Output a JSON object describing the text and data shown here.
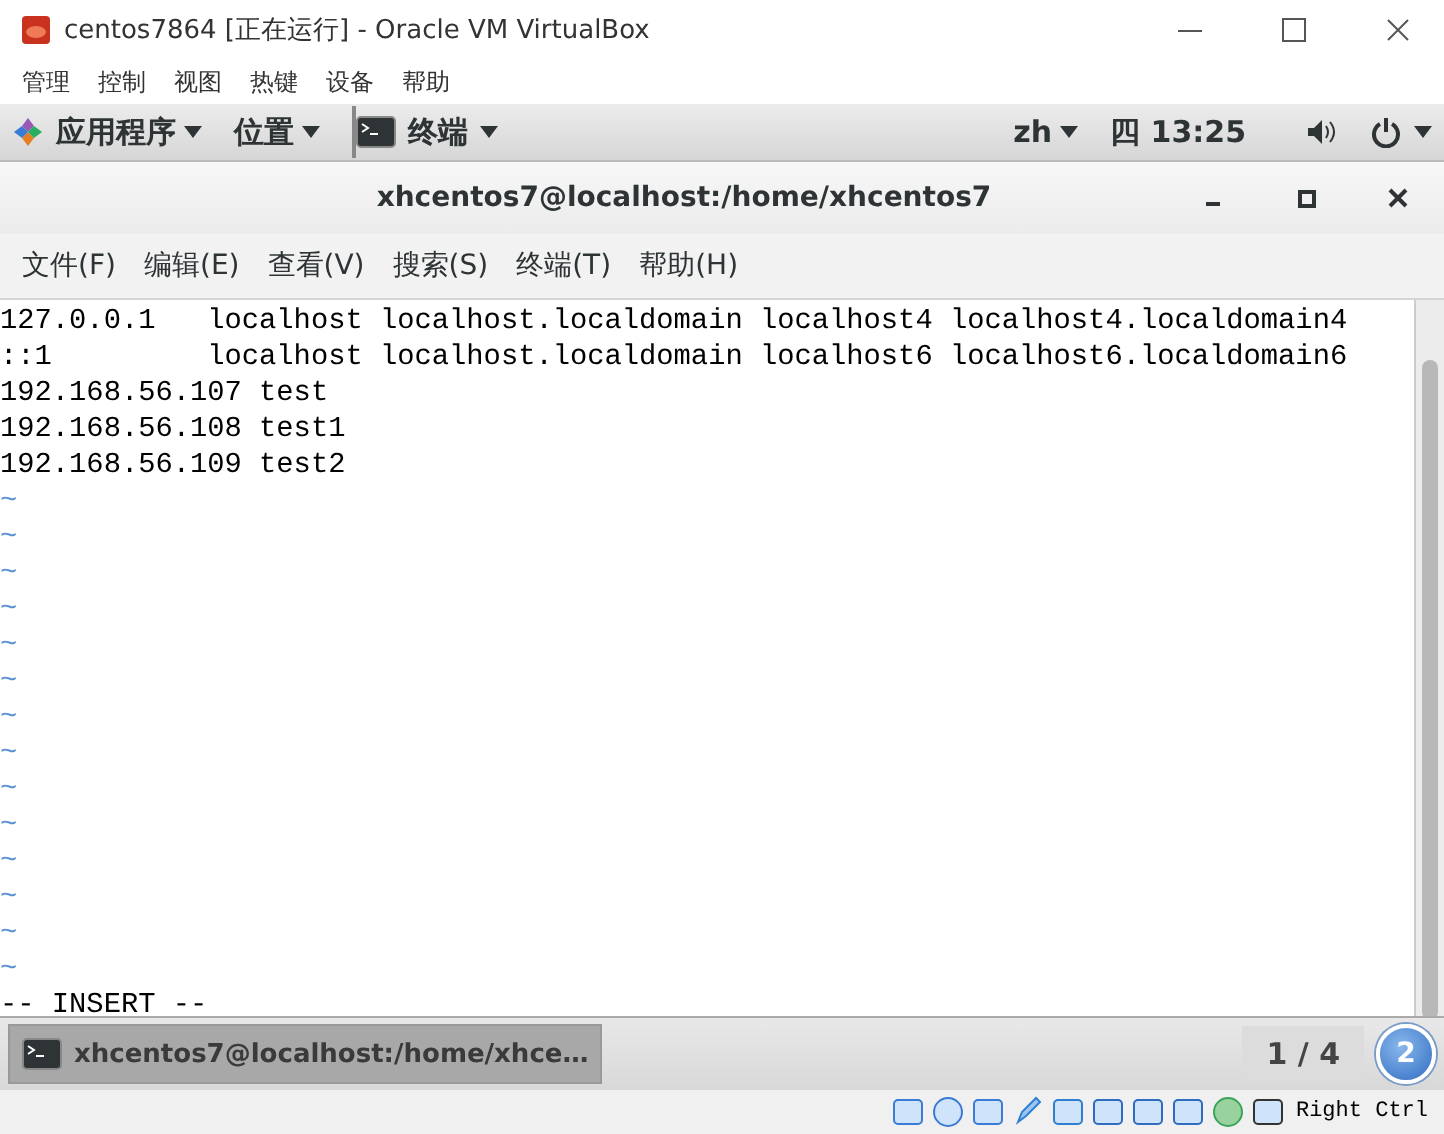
{
  "host_window": {
    "title": "centos7864 [正在运行] - Oracle VM VirtualBox"
  },
  "host_menu": [
    "管理",
    "控制",
    "视图",
    "热键",
    "设备",
    "帮助"
  ],
  "top_bar": {
    "applications": "应用程序",
    "places": "位置",
    "active_app": "终端",
    "input_method": "zh",
    "clock": "四 13:25"
  },
  "terminal": {
    "title": "xhcentos7@localhost:/home/xhcentos7",
    "menu": [
      "文件(F)",
      "编辑(E)",
      "查看(V)",
      "搜索(S)",
      "终端(T)",
      "帮助(H)"
    ],
    "lines": [
      "127.0.0.1   localhost localhost.localdomain localhost4 localhost4.localdomain4",
      "::1         localhost localhost.localdomain localhost6 localhost6.localdomain6",
      "192.168.56.107 test",
      "192.168.56.108 test1",
      "192.168.56.109 test2"
    ],
    "tildes": [
      "~",
      "~",
      "~",
      "~",
      "~",
      "~",
      "~",
      "~",
      "~",
      "~",
      "~",
      "~",
      "~",
      "~"
    ],
    "mode_line": "-- INSERT --"
  },
  "taskbar": {
    "windows": [
      {
        "label": "xhcentos7@localhost:/home/xhce…",
        "selected": true
      }
    ],
    "workspace": "1 / 4",
    "notifications": "2"
  },
  "vbox_status": {
    "host_key": "Right Ctrl"
  }
}
